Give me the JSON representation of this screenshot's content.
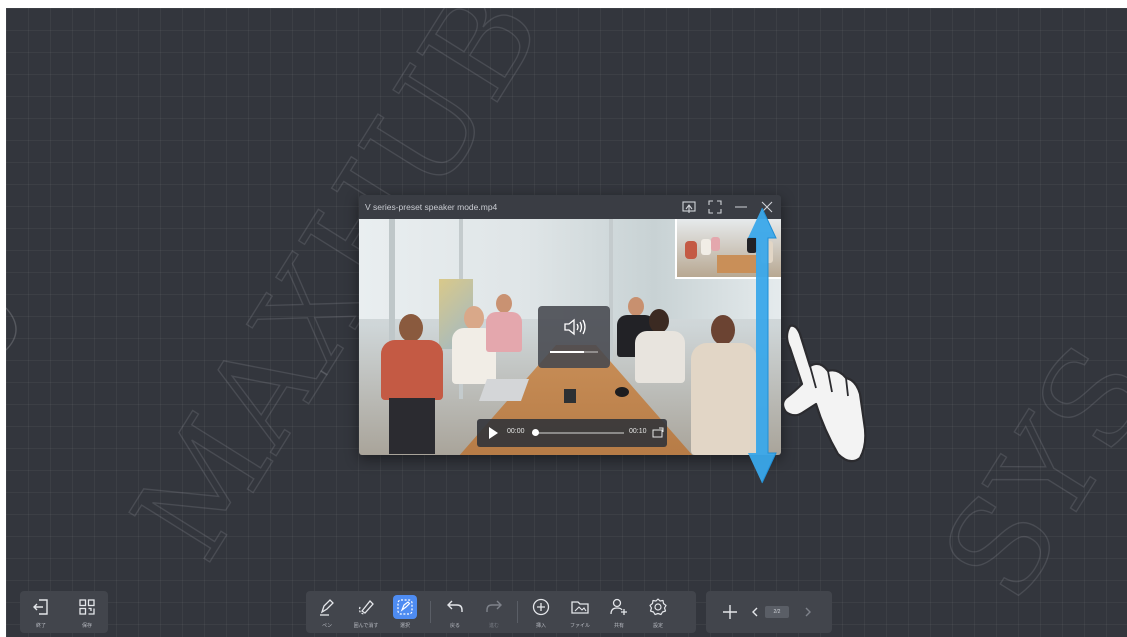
{
  "player": {
    "title": "V series-preset speaker mode.mp4",
    "icons": [
      "cast-icon",
      "fullscreen-icon",
      "minimize-icon",
      "close-icon"
    ],
    "volume_level": 0.7,
    "volume_icon": "speaker-icon",
    "current_time": "00:00",
    "duration": "00:10",
    "progress": 0.0
  },
  "watermark": {
    "left_text": "MAXHUB",
    "right_text": "SYS"
  },
  "toolbar": {
    "left": [
      {
        "icon": "exit-icon",
        "label": "終了"
      },
      {
        "icon": "grid-icon",
        "label": "保存"
      }
    ],
    "center": [
      {
        "icon": "pen-icon",
        "label": "ペン"
      },
      {
        "icon": "brush-icon",
        "label": "囲んで消す"
      },
      {
        "icon": "select-icon",
        "label": "選択",
        "active": true
      },
      {
        "icon": "undo-icon",
        "label": "戻る"
      },
      {
        "icon": "redo-icon",
        "label": "進む"
      },
      {
        "icon": "insert-icon",
        "label": "挿入"
      },
      {
        "icon": "folder-icon",
        "label": "ファイル"
      },
      {
        "icon": "share-icon",
        "label": "共有"
      },
      {
        "icon": "settings-icon",
        "label": "設定"
      }
    ],
    "right": {
      "add_icon": "plus-icon",
      "prev_icon": "chevron-left-icon",
      "page": "2/2",
      "next_icon": "chevron-right-icon"
    }
  },
  "colors": {
    "canvas": "#33363d",
    "accent": "#4e8cf2",
    "gesture_arrow": "#3aa8ea"
  }
}
